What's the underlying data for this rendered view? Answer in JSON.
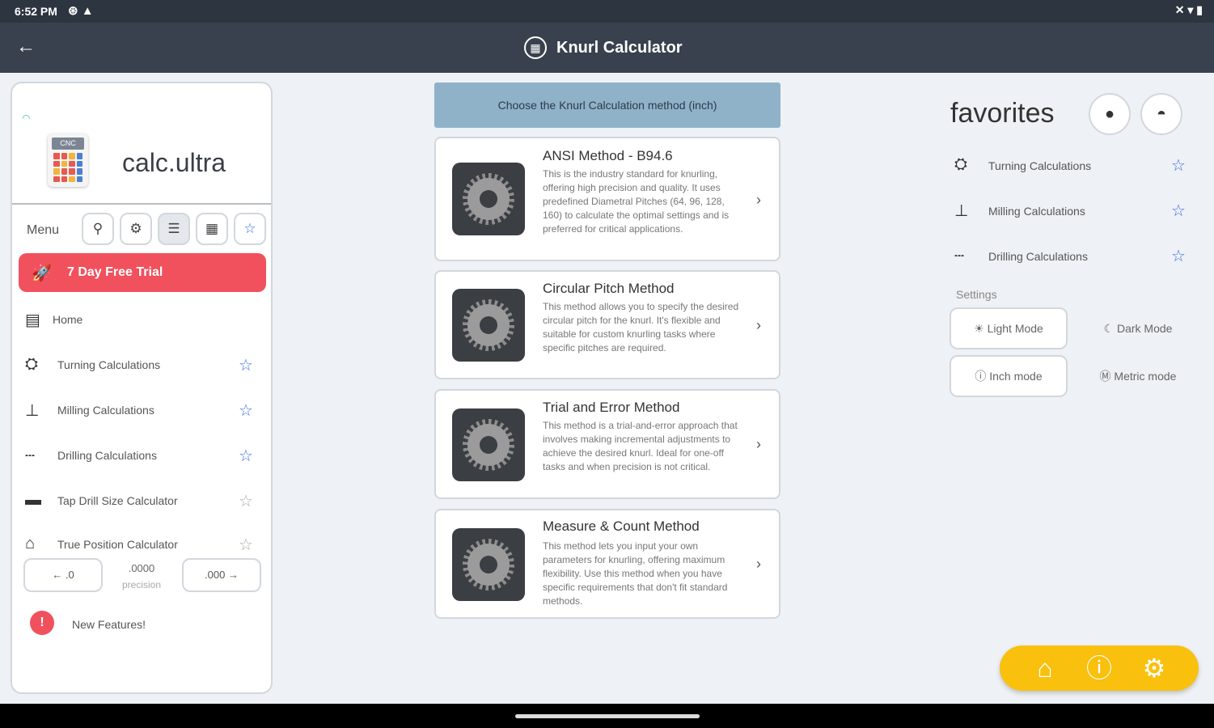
{
  "status_bar": {
    "time": "6:52 PM"
  },
  "app_bar": {
    "title": "Knurl Calculator"
  },
  "sidebar": {
    "logo_badge": "CNC",
    "brand": "calc.ultra",
    "menu_label": "Menu",
    "trial_button": "7 Day Free Trial",
    "items": [
      {
        "label": "Home"
      },
      {
        "label": "Turning Calculations",
        "starred": true
      },
      {
        "label": "Milling Calculations",
        "starred": true
      },
      {
        "label": "Drilling Calculations",
        "starred": true
      },
      {
        "label": "Tap Drill Size Calculator",
        "starred": false
      },
      {
        "label": "True Position Calculator",
        "starred": false
      }
    ],
    "precision": {
      "left_button": "← .0",
      "value": ".0000",
      "label": "precision",
      "right_button": ".000 →"
    },
    "new_features": "New Features!"
  },
  "center": {
    "header": "Choose the Knurl Calculation method (inch)",
    "methods": [
      {
        "title": "ANSI Method - B94.6",
        "description": "This is the industry standard for knurling, offering high precision and quality. It uses predefined Diametral Pitches (64, 96, 128, 160) to calculate the optimal settings and is preferred for critical applications."
      },
      {
        "title": "Circular Pitch Method",
        "description": "This method allows you to specify the desired circular pitch for the knurl. It's flexible and suitable for custom knurling tasks where specific pitches are required."
      },
      {
        "title": "Trial and Error Method",
        "description": "This method is a trial-and-error approach that involves making incremental adjustments to achieve the desired knurl. Ideal for one-off tasks and when precision is not critical."
      },
      {
        "title": "Measure & Count Method",
        "description": "This method lets you input your own parameters for knurling, offering maximum flexibility. Use this method when you have specific requirements that don't fit standard methods."
      }
    ]
  },
  "favorites": {
    "title": "favorites",
    "items": [
      {
        "label": "Turning Calculations"
      },
      {
        "label": "Milling Calculations"
      },
      {
        "label": "Drilling Calculations"
      }
    ],
    "settings_label": "Settings",
    "light_mode": "Light Mode",
    "dark_mode": "Dark Mode",
    "inch_mode": "Inch mode",
    "metric_mode": "Metric mode"
  },
  "colors": {
    "trial": "#f0515d",
    "star": "#3d6fe0",
    "fab": "#f9c10e",
    "header": "#8fb2c9"
  }
}
